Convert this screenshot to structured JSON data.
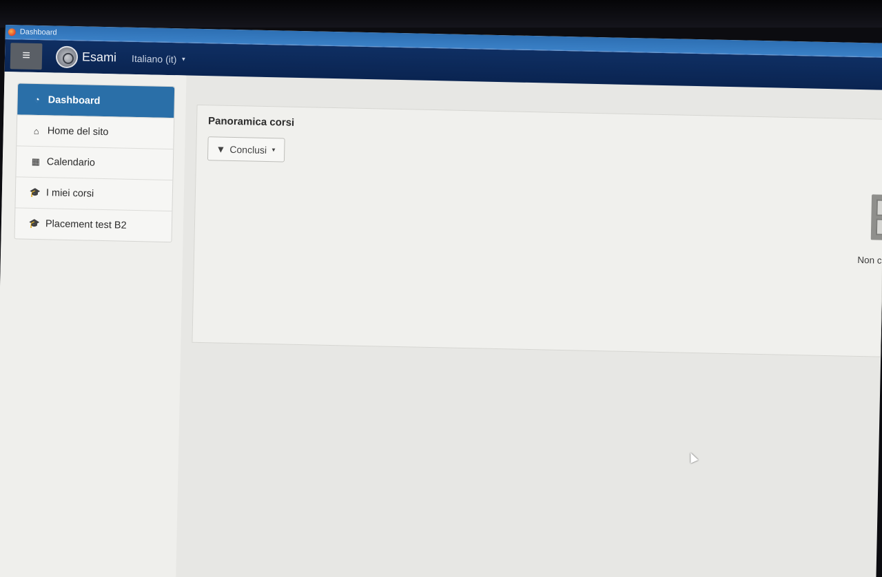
{
  "browser": {
    "tab_title": "Dashboard"
  },
  "navbar": {
    "brand": "Esami",
    "language": "Italiano (it)"
  },
  "sidebar": {
    "items": [
      {
        "label": "Dashboard",
        "icon": "dashboard-icon",
        "active": true
      },
      {
        "label": "Home del sito",
        "icon": "home-icon"
      },
      {
        "label": "Calendario",
        "icon": "calendar-icon"
      },
      {
        "label": "I miei corsi",
        "icon": "graduation-cap-icon"
      },
      {
        "label": "Placement test B2",
        "icon": "graduation-cap-icon"
      }
    ]
  },
  "main": {
    "card_title": "Panoramica corsi",
    "filter_label": "Conclusi",
    "empty_text": "Non ci sono corsi"
  },
  "colors": {
    "navbar": "#0f2f63",
    "active": "#2a6fa8"
  }
}
